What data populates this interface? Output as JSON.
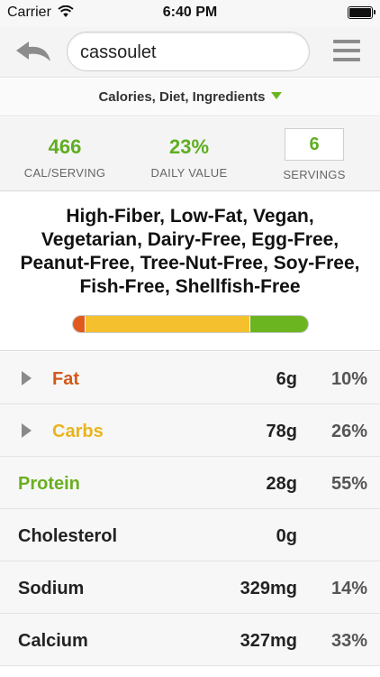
{
  "status_bar": {
    "carrier": "Carrier",
    "time": "6:40 PM",
    "wifi_icon": "wifi-icon",
    "battery_icon": "battery-full-icon"
  },
  "toolbar": {
    "back_icon": "back-arrow-icon",
    "search_value": "cassoulet",
    "menu_icon": "hamburger-menu-icon"
  },
  "dropdown": {
    "label": "Calories, Diet, Ingredients",
    "caret_icon": "caret-down-icon"
  },
  "stats": {
    "calories": {
      "value": "466",
      "label": "CAL/SERVING"
    },
    "daily_value": {
      "value": "23%",
      "label": "DAILY VALUE"
    },
    "servings": {
      "value": "6",
      "label": "SERVINGS"
    }
  },
  "diet_labels": "High-Fiber, Low-Fat, Vegan, Vegetarian, Dairy-Free, Egg-Free, Peanut-Free, Tree-Nut-Free, Soy-Free, Fish-Free, Shellfish-Free",
  "macro_bar": {
    "segments": [
      {
        "name": "fat",
        "fraction": 0.05,
        "color": "#e05a1e"
      },
      {
        "name": "carbs",
        "fraction": 0.7,
        "color": "#f5c02e"
      },
      {
        "name": "protein",
        "fraction": 0.25,
        "color": "#6bb521"
      }
    ]
  },
  "colors": {
    "fat": "#d25a1a",
    "carbs": "#e9b41c",
    "protein": "#6aae21",
    "default": "#222222",
    "accent": "#5fae22"
  },
  "nutrients": [
    {
      "name": "Fat",
      "amount": "6g",
      "pct": "10%",
      "expandable": true,
      "color_key": "fat"
    },
    {
      "name": "Carbs",
      "amount": "78g",
      "pct": "26%",
      "expandable": true,
      "color_key": "carbs"
    },
    {
      "name": "Protein",
      "amount": "28g",
      "pct": "55%",
      "expandable": false,
      "color_key": "protein"
    },
    {
      "name": "Cholesterol",
      "amount": "0g",
      "pct": "",
      "expandable": false,
      "color_key": "default"
    },
    {
      "name": "Sodium",
      "amount": "329mg",
      "pct": "14%",
      "expandable": false,
      "color_key": "default"
    },
    {
      "name": "Calcium",
      "amount": "327mg",
      "pct": "33%",
      "expandable": false,
      "color_key": "default"
    }
  ]
}
